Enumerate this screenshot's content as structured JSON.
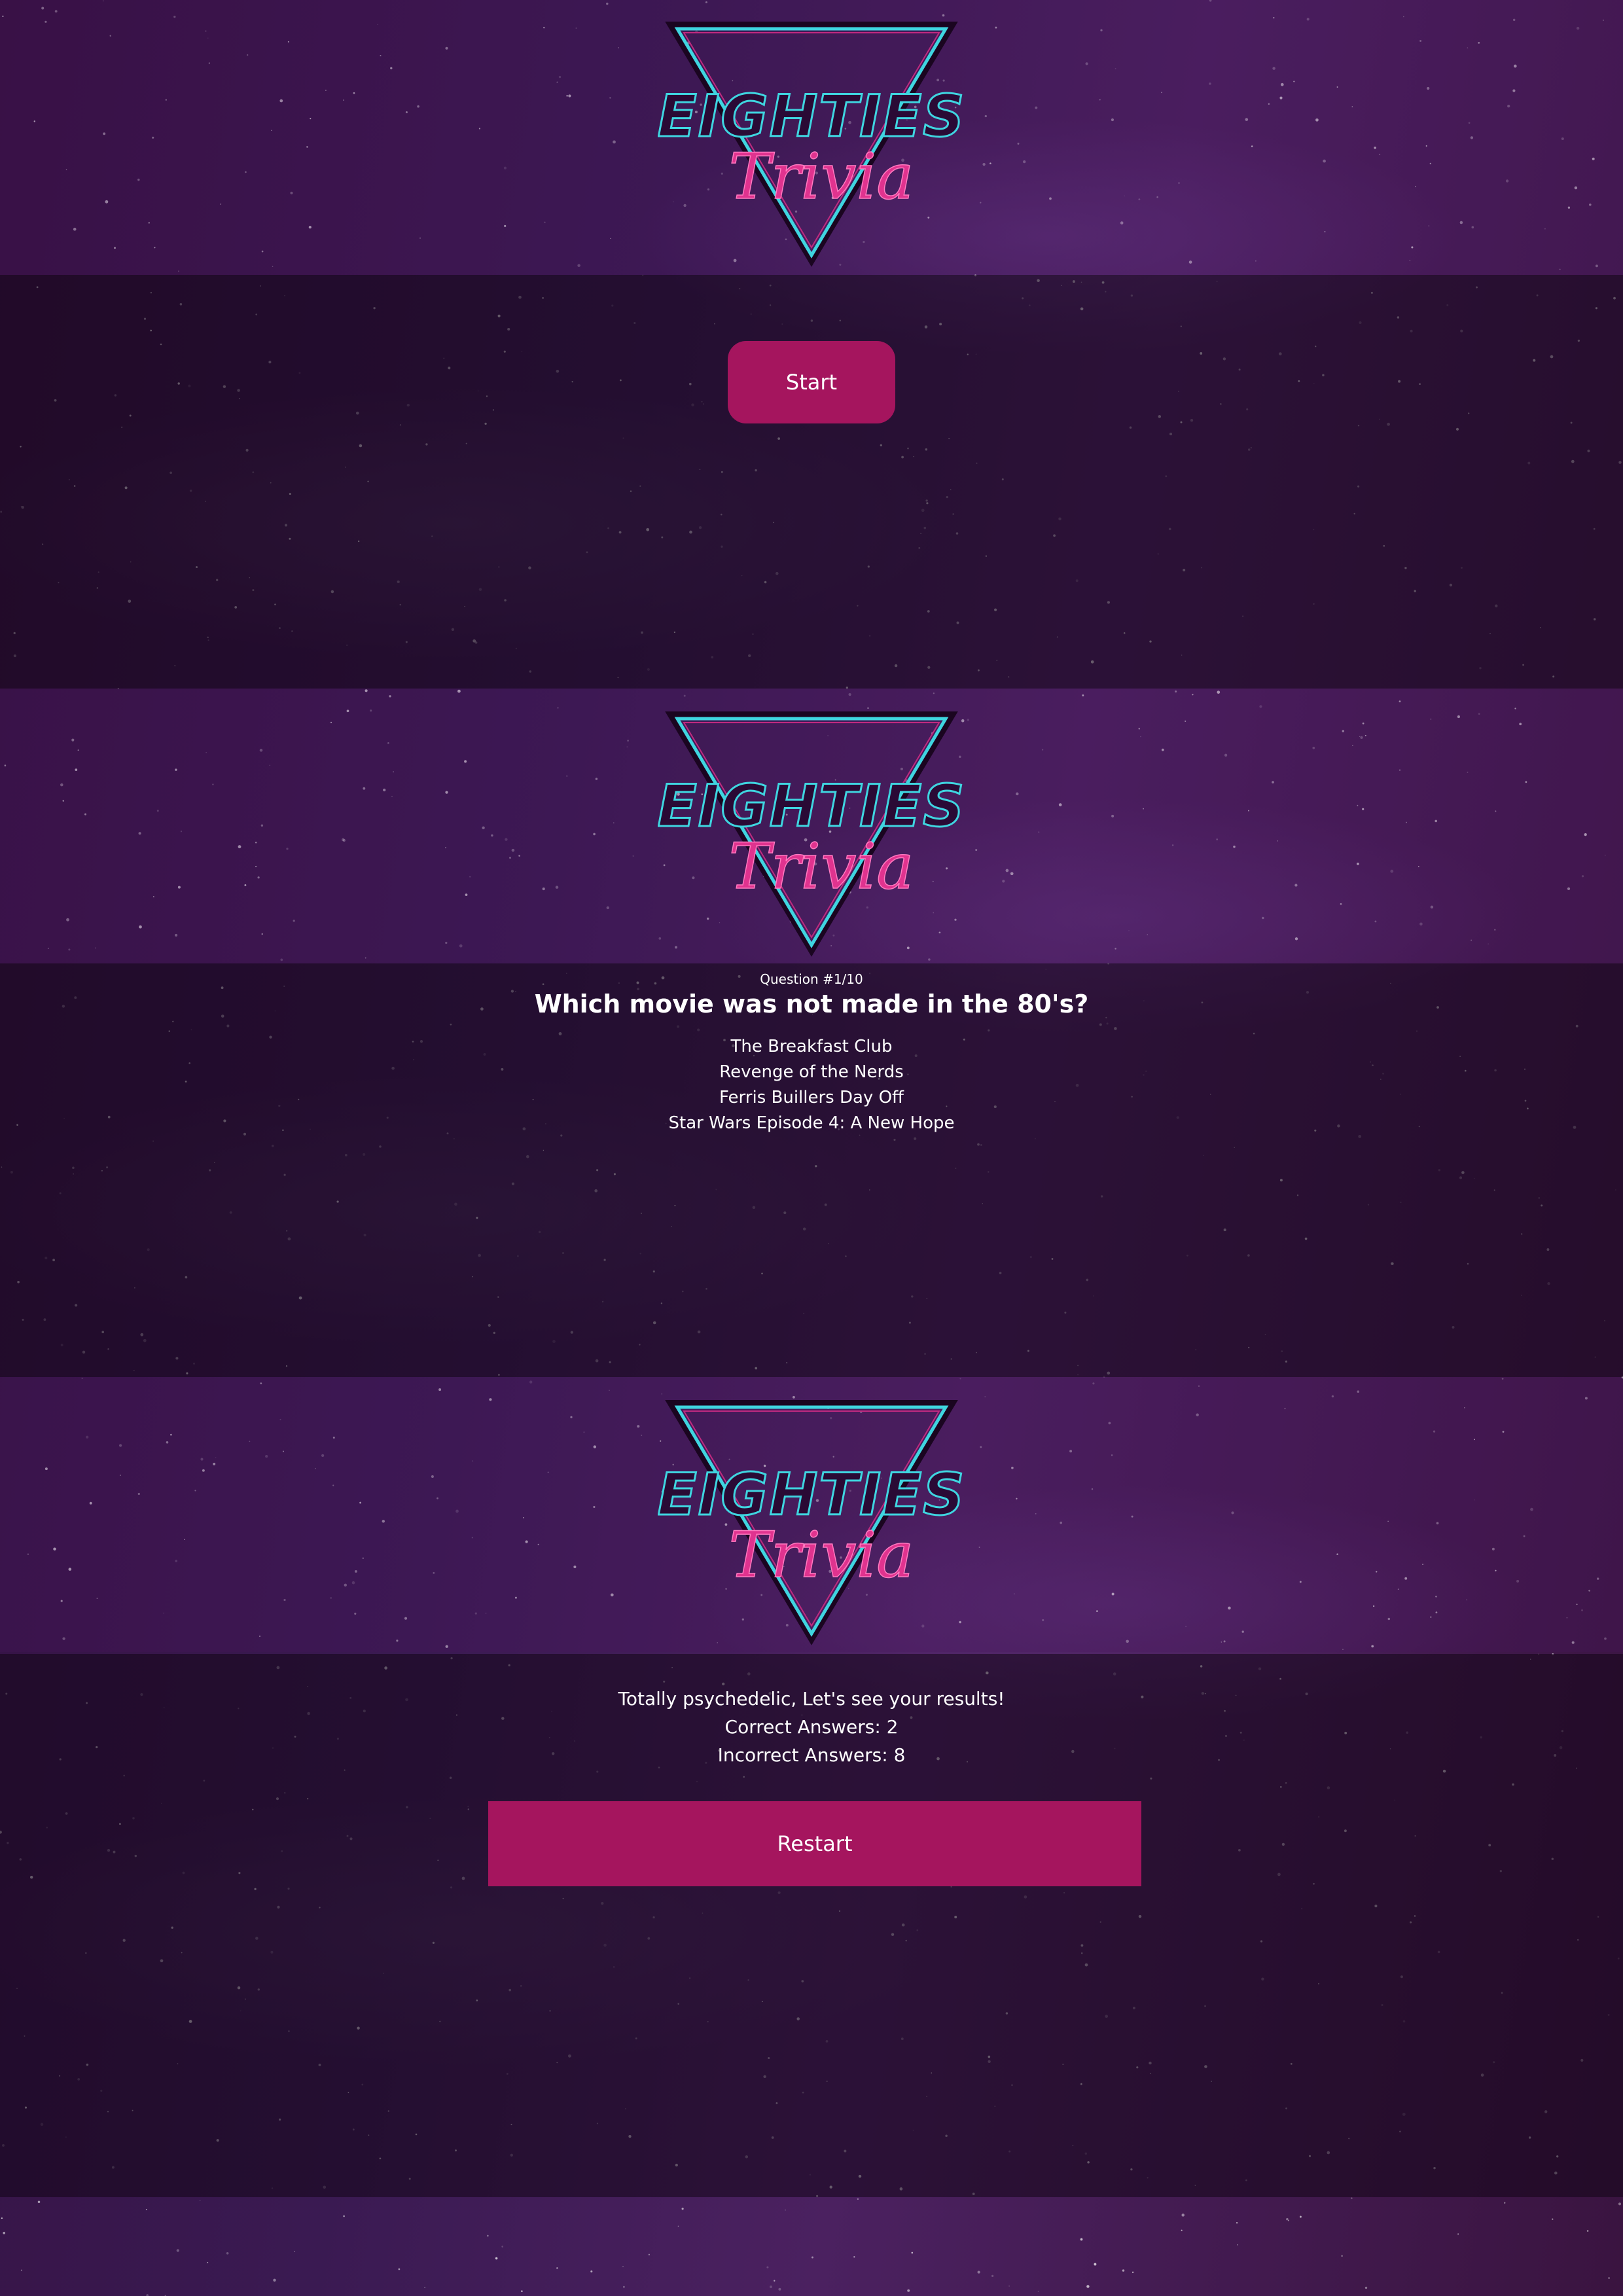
{
  "logo": {
    "line1": "EIGHTIES",
    "line2": "Trivia",
    "colors": {
      "cyan": "#3fd5e0",
      "magenta": "#e0338f"
    }
  },
  "start_screen": {
    "start_label": "Start"
  },
  "question_screen": {
    "counter": "Question #1/10",
    "question": "Which movie was not made in the 80's?",
    "answers": [
      "The Breakfast Club",
      "Revenge of the Nerds",
      "Ferris Buillers Day Off",
      "Star Wars Episode 4: A New Hope"
    ]
  },
  "results_screen": {
    "message": "Totally psychedelic, Let's see your results!",
    "correct": "Correct Answers: 2",
    "incorrect": "Incorrect Answers: 8",
    "restart_label": "Restart"
  },
  "colors": {
    "button": "#a5155e",
    "text": "#ffffff"
  }
}
